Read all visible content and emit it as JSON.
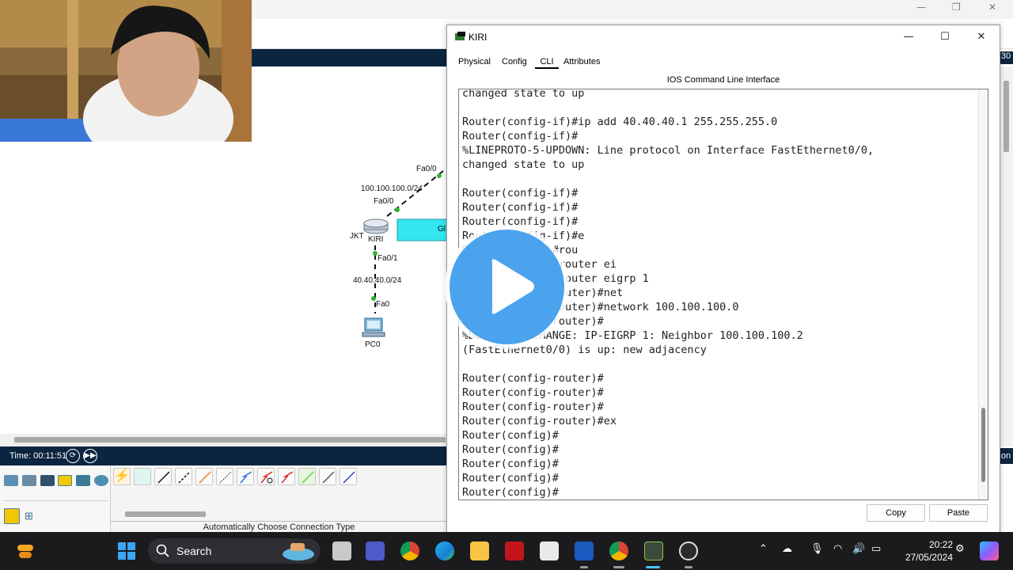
{
  "pt": {
    "time_label": "Time: 00:11:51",
    "auto_connection_label": "Automatically Choose Connection Type",
    "right_edge_top": "30",
    "right_edge_bottom": "on",
    "topology": {
      "link_top_label": "100.100.100.0/24",
      "fa00_upper": "Fa0/0",
      "fa00_lower": "Fa0/0",
      "router_location": "JKT",
      "router_name": "KIRI",
      "fa01": "Fa0/1",
      "lan_label": "40.40.40.0/24",
      "pc_fa0": "Fa0",
      "pc_name": "PC0",
      "cyan_label": "Gl"
    }
  },
  "cli": {
    "window_title": "KIRI",
    "tabs": [
      "Physical",
      "Config",
      "CLI",
      "Attributes"
    ],
    "active_tab": "CLI",
    "header": "IOS Command Line Interface",
    "copy_button": "Copy",
    "paste_button": "Paste",
    "lines": [
      "changed state to up",
      "",
      "Router(config-if)#ip add 40.40.40.1 255.255.255.0",
      "Router(config-if)#",
      "%LINEPROTO-5-UPDOWN: Line protocol on Interface FastEthernet0/0,",
      "changed state to up",
      "",
      "Router(config-if)#",
      "Router(config-if)#",
      "Router(config-if)#",
      "Router(config-if)#e",
      "Router(config)#rou",
      "Router(config)#router ei",
      "Router(config)#router eigrp 1",
      "Router(config-router)#net",
      "Router(config-router)#network 100.100.100.0",
      "Router(config-router)#",
      "%DUAL-5-NBRCHANGE: IP-EIGRP 1: Neighbor 100.100.100.2",
      "(FastEthernet0/0) is up: new adjacency",
      "",
      "Router(config-router)#",
      "Router(config-router)#",
      "Router(config-router)#",
      "Router(config-router)#ex",
      "Router(config)#",
      "Router(config)#",
      "Router(config)#",
      "Router(config)#",
      "Router(config)#"
    ]
  },
  "taskbar": {
    "search_label": "Search",
    "time": "20:22",
    "date": "27/05/2024"
  },
  "colors": {
    "navy": "#0b2540",
    "play_blue": "#4aa3ec",
    "taskbar": "#1b1b1d",
    "cyan_box": "#33e6f0"
  }
}
